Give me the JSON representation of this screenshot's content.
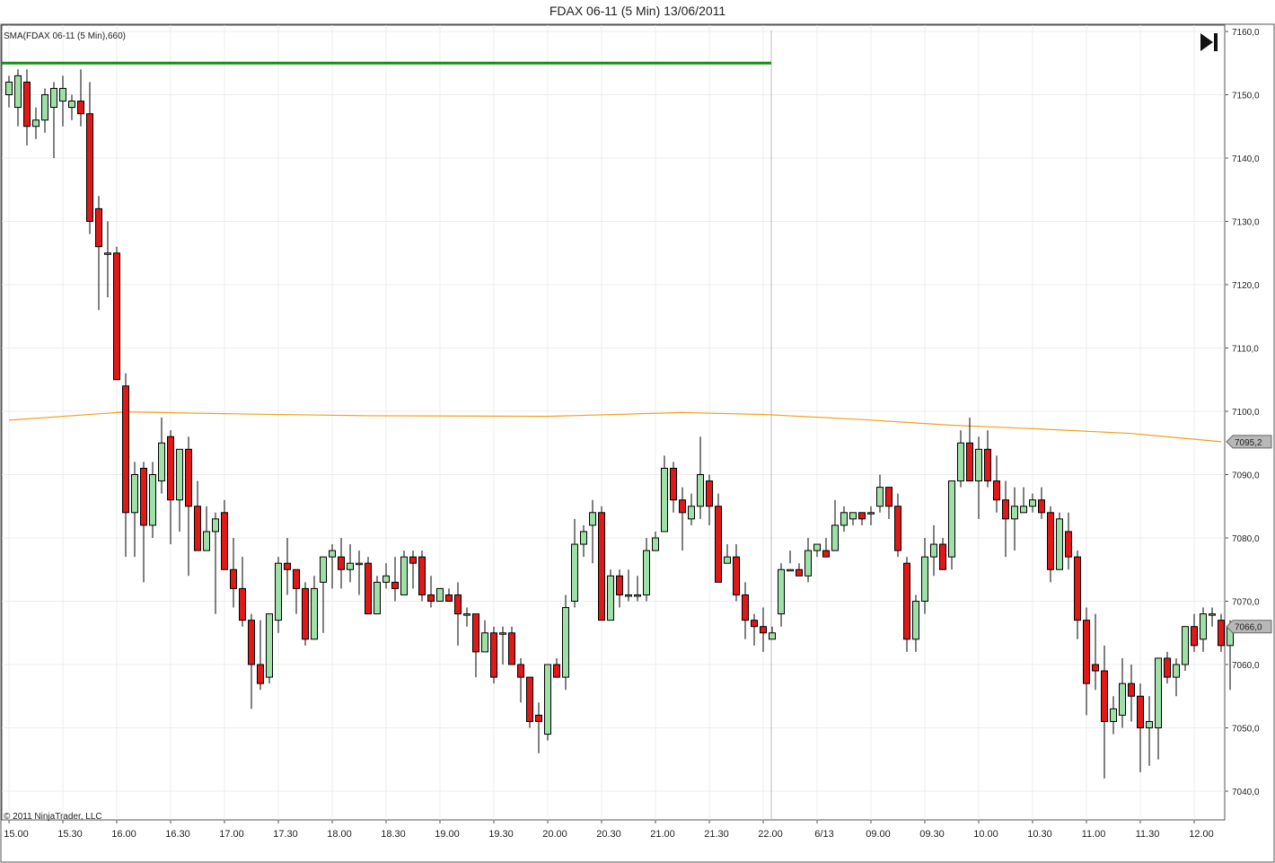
{
  "title": "FDAX 06-11 (5 Min)  13/06/2011",
  "indicator_label": "SMA(FDAX 06-11 (5 Min),660)",
  "copyright": "© 2011 NinjaTrader, LLC",
  "play_icon": "skip-to-end-icon",
  "colors": {
    "up_fill": "#9fe0a8",
    "down_fill": "#e01818",
    "sma": "#f0a020",
    "hline": "#1a8a1a",
    "grid": "#ececec",
    "separator": "#bbbbbb"
  },
  "chart_data": {
    "type": "candlestick",
    "ylim": [
      7035,
      7161
    ],
    "y_ticks": [
      "7040,0",
      "7050,0",
      "7060,0",
      "7070,0",
      "7080,0",
      "7090,0",
      "7100,0",
      "7110,0",
      "7120,0",
      "7130,0",
      "7140,0",
      "7150,0",
      "7160,0"
    ],
    "x_ticks": [
      {
        "label": "15.00",
        "bar": 0
      },
      {
        "label": "15.30",
        "bar": 6
      },
      {
        "label": "16.00",
        "bar": 12
      },
      {
        "label": "16.30",
        "bar": 18
      },
      {
        "label": "17.00",
        "bar": 24
      },
      {
        "label": "17.30",
        "bar": 30
      },
      {
        "label": "18.00",
        "bar": 36
      },
      {
        "label": "18.30",
        "bar": 42
      },
      {
        "label": "19.00",
        "bar": 48
      },
      {
        "label": "19.30",
        "bar": 54
      },
      {
        "label": "20.00",
        "bar": 60
      },
      {
        "label": "20.30",
        "bar": 66
      },
      {
        "label": "21.00",
        "bar": 72
      },
      {
        "label": "21.30",
        "bar": 78
      },
      {
        "label": "22.00",
        "bar": 84
      },
      {
        "label": "6/13",
        "bar": 90
      },
      {
        "label": "09.00",
        "bar": 96
      },
      {
        "label": "09.30",
        "bar": 102
      },
      {
        "label": "10.00",
        "bar": 108
      },
      {
        "label": "10.30",
        "bar": 114
      },
      {
        "label": "11.00",
        "bar": 120
      },
      {
        "label": "11.30",
        "bar": 126
      },
      {
        "label": "12.00",
        "bar": 132
      }
    ],
    "session_break_bar": 85,
    "horizontal_line": {
      "value": 7155,
      "end_bar": 85
    },
    "price_markers": [
      {
        "label": "7095,2",
        "value": 7095.2
      },
      {
        "label": "7066,0",
        "value": 7066.0
      }
    ],
    "candles": [
      {
        "o": 7150,
        "h": 7153,
        "l": 7148,
        "c": 7152
      },
      {
        "o": 7148,
        "h": 7154,
        "l": 7145,
        "c": 7153
      },
      {
        "o": 7152,
        "h": 7154,
        "l": 7142,
        "c": 7145
      },
      {
        "o": 7145,
        "h": 7148,
        "l": 7143,
        "c": 7146
      },
      {
        "o": 7146,
        "h": 7151,
        "l": 7144,
        "c": 7150
      },
      {
        "o": 7148,
        "h": 7152,
        "l": 7140,
        "c": 7151
      },
      {
        "o": 7149,
        "h": 7153,
        "l": 7145,
        "c": 7151
      },
      {
        "o": 7148,
        "h": 7150,
        "l": 7146,
        "c": 7149
      },
      {
        "o": 7149,
        "h": 7154,
        "l": 7145,
        "c": 7147
      },
      {
        "o": 7147,
        "h": 7152,
        "l": 7128,
        "c": 7130
      },
      {
        "o": 7132,
        "h": 7134,
        "l": 7116,
        "c": 7126
      },
      {
        "o": 7125,
        "h": 7130,
        "l": 7118,
        "c": 7125
      },
      {
        "o": 7125,
        "h": 7126,
        "l": 7106,
        "c": 7105
      },
      {
        "o": 7104,
        "h": 7106,
        "l": 7077,
        "c": 7084
      },
      {
        "o": 7084,
        "h": 7092,
        "l": 7077,
        "c": 7090
      },
      {
        "o": 7091,
        "h": 7092,
        "l": 7073,
        "c": 7082
      },
      {
        "o": 7082,
        "h": 7092,
        "l": 7080,
        "c": 7090
      },
      {
        "o": 7089,
        "h": 7099,
        "l": 7087,
        "c": 7095
      },
      {
        "o": 7096,
        "h": 7097,
        "l": 7079,
        "c": 7086
      },
      {
        "o": 7086,
        "h": 7093,
        "l": 7081,
        "c": 7094
      },
      {
        "o": 7094,
        "h": 7096,
        "l": 7074,
        "c": 7085
      },
      {
        "o": 7085,
        "h": 7089,
        "l": 7079,
        "c": 7078
      },
      {
        "o": 7078,
        "h": 7085,
        "l": 7078,
        "c": 7081
      },
      {
        "o": 7081,
        "h": 7084,
        "l": 7068,
        "c": 7083
      },
      {
        "o": 7084,
        "h": 7086,
        "l": 7076,
        "c": 7075
      },
      {
        "o": 7075,
        "h": 7080,
        "l": 7069,
        "c": 7072
      },
      {
        "o": 7072,
        "h": 7077,
        "l": 7066,
        "c": 7067
      },
      {
        "o": 7067,
        "h": 7068,
        "l": 7053,
        "c": 7060
      },
      {
        "o": 7060,
        "h": 7067,
        "l": 7056,
        "c": 7057
      },
      {
        "o": 7058,
        "h": 7068,
        "l": 7057,
        "c": 7068
      },
      {
        "o": 7067,
        "h": 7077,
        "l": 7065,
        "c": 7076
      },
      {
        "o": 7076,
        "h": 7080,
        "l": 7071,
        "c": 7075
      },
      {
        "o": 7075,
        "h": 7075,
        "l": 7068,
        "c": 7072
      },
      {
        "o": 7072,
        "h": 7073,
        "l": 7063,
        "c": 7064
      },
      {
        "o": 7064,
        "h": 7074,
        "l": 7064,
        "c": 7072
      },
      {
        "o": 7073,
        "h": 7076,
        "l": 7065,
        "c": 7077
      },
      {
        "o": 7077,
        "h": 7079,
        "l": 7072,
        "c": 7078
      },
      {
        "o": 7077,
        "h": 7080,
        "l": 7072,
        "c": 7075
      },
      {
        "o": 7075,
        "h": 7079,
        "l": 7073,
        "c": 7076
      },
      {
        "o": 7076,
        "h": 7078,
        "l": 7071,
        "c": 7076
      },
      {
        "o": 7076,
        "h": 7077,
        "l": 7068,
        "c": 7068
      },
      {
        "o": 7068,
        "h": 7074,
        "l": 7068,
        "c": 7073
      },
      {
        "o": 7073,
        "h": 7076,
        "l": 7072,
        "c": 7074
      },
      {
        "o": 7073,
        "h": 7077,
        "l": 7070,
        "c": 7072
      },
      {
        "o": 7071,
        "h": 7078,
        "l": 7071,
        "c": 7077
      },
      {
        "o": 7077,
        "h": 7078,
        "l": 7072,
        "c": 7076
      },
      {
        "o": 7077,
        "h": 7078,
        "l": 7070,
        "c": 7071
      },
      {
        "o": 7071,
        "h": 7074,
        "l": 7069,
        "c": 7070
      },
      {
        "o": 7070,
        "h": 7072,
        "l": 7070,
        "c": 7072
      },
      {
        "o": 7071,
        "h": 7072,
        "l": 7070,
        "c": 7070
      },
      {
        "o": 7071,
        "h": 7073,
        "l": 7063,
        "c": 7068
      },
      {
        "o": 7068,
        "h": 7069,
        "l": 7066,
        "c": 7068
      },
      {
        "o": 7068,
        "h": 7068,
        "l": 7058,
        "c": 7062
      },
      {
        "o": 7062,
        "h": 7067,
        "l": 7062,
        "c": 7065
      },
      {
        "o": 7065,
        "h": 7066,
        "l": 7057,
        "c": 7058
      },
      {
        "o": 7065,
        "h": 7066,
        "l": 7060,
        "c": 7065
      },
      {
        "o": 7065,
        "h": 7066,
        "l": 7060,
        "c": 7060
      },
      {
        "o": 7060,
        "h": 7061,
        "l": 7054,
        "c": 7058
      },
      {
        "o": 7058,
        "h": 7058,
        "l": 7050,
        "c": 7051
      },
      {
        "o": 7052,
        "h": 7054,
        "l": 7046,
        "c": 7051
      },
      {
        "o": 7049,
        "h": 7060,
        "l": 7048,
        "c": 7060
      },
      {
        "o": 7060,
        "h": 7061,
        "l": 7058,
        "c": 7058
      },
      {
        "o": 7058,
        "h": 7071,
        "l": 7056,
        "c": 7069
      },
      {
        "o": 7070,
        "h": 7083,
        "l": 7069,
        "c": 7079
      },
      {
        "o": 7079,
        "h": 7082,
        "l": 7077,
        "c": 7081
      },
      {
        "o": 7082,
        "h": 7086,
        "l": 7076,
        "c": 7084
      },
      {
        "o": 7084,
        "h": 7085,
        "l": 7068,
        "c": 7067
      },
      {
        "o": 7067,
        "h": 7075,
        "l": 7068,
        "c": 7074
      },
      {
        "o": 7074,
        "h": 7075,
        "l": 7069,
        "c": 7071
      },
      {
        "o": 7071,
        "h": 7075,
        "l": 7070,
        "c": 7071
      },
      {
        "o": 7071,
        "h": 7074,
        "l": 7070,
        "c": 7071
      },
      {
        "o": 7071,
        "h": 7080,
        "l": 7070,
        "c": 7078
      },
      {
        "o": 7078,
        "h": 7081,
        "l": 7078,
        "c": 7080
      },
      {
        "o": 7081,
        "h": 7093,
        "l": 7081,
        "c": 7091
      },
      {
        "o": 7091,
        "h": 7092,
        "l": 7084,
        "c": 7086
      },
      {
        "o": 7086,
        "h": 7088,
        "l": 7078,
        "c": 7084
      },
      {
        "o": 7083,
        "h": 7087,
        "l": 7082,
        "c": 7085
      },
      {
        "o": 7085,
        "h": 7096,
        "l": 7083,
        "c": 7090
      },
      {
        "o": 7089,
        "h": 7090,
        "l": 7082,
        "c": 7085
      },
      {
        "o": 7085,
        "h": 7087,
        "l": 7075,
        "c": 7073
      },
      {
        "o": 7076,
        "h": 7079,
        "l": 7077,
        "c": 7077
      },
      {
        "o": 7077,
        "h": 7079,
        "l": 7070,
        "c": 7071
      },
      {
        "o": 7071,
        "h": 7073,
        "l": 7064,
        "c": 7067
      },
      {
        "o": 7067,
        "h": 7068,
        "l": 7063,
        "c": 7066
      },
      {
        "o": 7066,
        "h": 7069,
        "l": 7062,
        "c": 7065
      },
      {
        "o": 7064,
        "h": 7066,
        "l": 7064,
        "c": 7065
      },
      {
        "o": 7068,
        "h": 7076,
        "l": 7066,
        "c": 7075
      },
      {
        "o": 7075,
        "h": 7078,
        "l": 7076,
        "c": 7075
      },
      {
        "o": 7075,
        "h": 7076,
        "l": 7074,
        "c": 7074
      },
      {
        "o": 7074,
        "h": 7080,
        "l": 7073,
        "c": 7078
      },
      {
        "o": 7078,
        "h": 7079,
        "l": 7077,
        "c": 7079
      },
      {
        "o": 7078,
        "h": 7080,
        "l": 7077,
        "c": 7077
      },
      {
        "o": 7078,
        "h": 7086,
        "l": 7078,
        "c": 7082
      },
      {
        "o": 7082,
        "h": 7085,
        "l": 7081,
        "c": 7084
      },
      {
        "o": 7083,
        "h": 7084,
        "l": 7082,
        "c": 7084
      },
      {
        "o": 7084,
        "h": 7084,
        "l": 7082,
        "c": 7083
      },
      {
        "o": 7084,
        "h": 7085,
        "l": 7082,
        "c": 7084
      },
      {
        "o": 7085,
        "h": 7090,
        "l": 7084,
        "c": 7088
      },
      {
        "o": 7088,
        "h": 7088,
        "l": 7083,
        "c": 7085
      },
      {
        "o": 7085,
        "h": 7087,
        "l": 7077,
        "c": 7078
      },
      {
        "o": 7076,
        "h": 7077,
        "l": 7062,
        "c": 7064
      },
      {
        "o": 7064,
        "h": 7071,
        "l": 7062,
        "c": 7070
      },
      {
        "o": 7070,
        "h": 7080,
        "l": 7068,
        "c": 7077
      },
      {
        "o": 7077,
        "h": 7082,
        "l": 7074,
        "c": 7079
      },
      {
        "o": 7079,
        "h": 7080,
        "l": 7075,
        "c": 7075
      },
      {
        "o": 7077,
        "h": 7089,
        "l": 7075,
        "c": 7089
      },
      {
        "o": 7089,
        "h": 7097,
        "l": 7088,
        "c": 7095
      },
      {
        "o": 7095,
        "h": 7099,
        "l": 7089,
        "c": 7089
      },
      {
        "o": 7089,
        "h": 7096,
        "l": 7083,
        "c": 7094
      },
      {
        "o": 7094,
        "h": 7097,
        "l": 7088,
        "c": 7089
      },
      {
        "o": 7089,
        "h": 7093,
        "l": 7084,
        "c": 7086
      },
      {
        "o": 7086,
        "h": 7089,
        "l": 7077,
        "c": 7083
      },
      {
        "o": 7083,
        "h": 7088,
        "l": 7078,
        "c": 7085
      },
      {
        "o": 7084,
        "h": 7088,
        "l": 7084,
        "c": 7085
      },
      {
        "o": 7085,
        "h": 7087,
        "l": 7084,
        "c": 7086
      },
      {
        "o": 7086,
        "h": 7088,
        "l": 7083,
        "c": 7084
      },
      {
        "o": 7084,
        "h": 7085,
        "l": 7073,
        "c": 7075
      },
      {
        "o": 7075,
        "h": 7084,
        "l": 7076,
        "c": 7083
      },
      {
        "o": 7081,
        "h": 7084,
        "l": 7075,
        "c": 7077
      },
      {
        "o": 7077,
        "h": 7078,
        "l": 7064,
        "c": 7067
      },
      {
        "o": 7067,
        "h": 7069,
        "l": 7052,
        "c": 7057
      },
      {
        "o": 7060,
        "h": 7068,
        "l": 7056,
        "c": 7059
      },
      {
        "o": 7059,
        "h": 7063,
        "l": 7042,
        "c": 7051
      },
      {
        "o": 7051,
        "h": 7055,
        "l": 7049,
        "c": 7053
      },
      {
        "o": 7052,
        "h": 7061,
        "l": 7050,
        "c": 7057
      },
      {
        "o": 7057,
        "h": 7060,
        "l": 7051,
        "c": 7055
      },
      {
        "o": 7055,
        "h": 7057,
        "l": 7043,
        "c": 7050
      },
      {
        "o": 7050,
        "h": 7055,
        "l": 7044,
        "c": 7051
      },
      {
        "o": 7050,
        "h": 7061,
        "l": 7045,
        "c": 7061
      },
      {
        "o": 7061,
        "h": 7062,
        "l": 7057,
        "c": 7058
      },
      {
        "o": 7058,
        "h": 7061,
        "l": 7055,
        "c": 7060
      },
      {
        "o": 7060,
        "h": 7066,
        "l": 7059,
        "c": 7066
      },
      {
        "o": 7066,
        "h": 7068,
        "l": 7062,
        "c": 7063
      },
      {
        "o": 7064,
        "h": 7069,
        "l": 7062,
        "c": 7068
      },
      {
        "o": 7068,
        "h": 7069,
        "l": 7066,
        "c": 7068
      },
      {
        "o": 7067,
        "h": 7068,
        "l": 7062,
        "c": 7063
      },
      {
        "o": 7063,
        "h": 7067,
        "l": 7056,
        "c": 7066
      }
    ],
    "sma": [
      {
        "bar": 0,
        "v": 7098.6
      },
      {
        "bar": 10,
        "v": 7099.6
      },
      {
        "bar": 13,
        "v": 7099.9
      },
      {
        "bar": 25,
        "v": 7099.6
      },
      {
        "bar": 40,
        "v": 7099.3
      },
      {
        "bar": 60,
        "v": 7099.2
      },
      {
        "bar": 75,
        "v": 7099.8
      },
      {
        "bar": 84,
        "v": 7099.5
      },
      {
        "bar": 95,
        "v": 7098.7
      },
      {
        "bar": 105,
        "v": 7097.8
      },
      {
        "bar": 115,
        "v": 7097.2
      },
      {
        "bar": 125,
        "v": 7096.5
      },
      {
        "bar": 135,
        "v": 7095.2
      }
    ]
  }
}
